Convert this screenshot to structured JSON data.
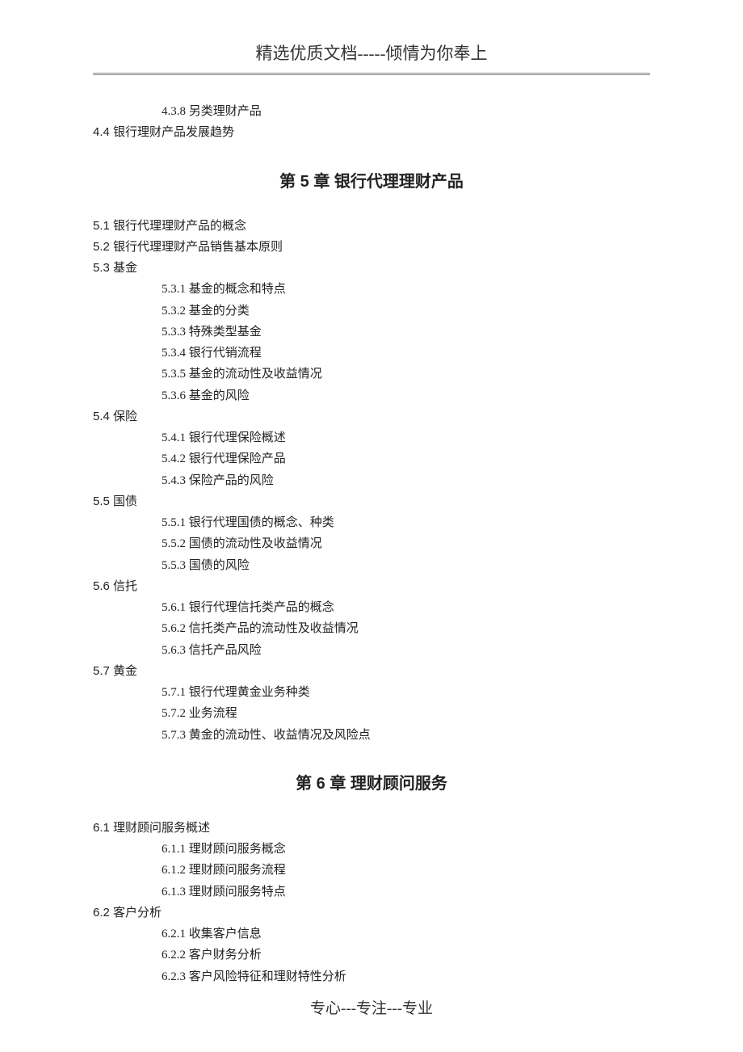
{
  "header": "精选优质文档-----倾情为你奉上",
  "footer": "专心---专注---专业",
  "preamble": {
    "item_4_3_8": "4.3.8 另类理财产品",
    "item_4_4": "4.4 银行理财产品发展趋势"
  },
  "chapter5": {
    "title": "第 5 章  银行代理理财产品",
    "s5_1": "5.1 银行代理理财产品的概念",
    "s5_2": "5.2 银行代理理财产品销售基本原则",
    "s5_3": "5.3 基金",
    "s5_3_1": "5.3.1 基金的概念和特点",
    "s5_3_2": "5.3.2 基金的分类",
    "s5_3_3": "5.3.3 特殊类型基金",
    "s5_3_4": "5.3.4 银行代销流程",
    "s5_3_5": "5.3.5 基金的流动性及收益情况",
    "s5_3_6": "5.3.6 基金的风险",
    "s5_4": "5.4 保险",
    "s5_4_1": "5.4.1 银行代理保险概述",
    "s5_4_2": "5.4.2 银行代理保险产品",
    "s5_4_3": "5.4.3 保险产品的风险",
    "s5_5": "5.5 国债",
    "s5_5_1": "5.5.1 银行代理国债的概念、种类",
    "s5_5_2": "5.5.2 国债的流动性及收益情况",
    "s5_5_3": "5.5.3 国债的风险",
    "s5_6": "5.6 信托",
    "s5_6_1": "5.6.1 银行代理信托类产品的概念",
    "s5_6_2": "5.6.2 信托类产品的流动性及收益情况",
    "s5_6_3": "5.6.3 信托产品风险",
    "s5_7": "5.7 黄金",
    "s5_7_1": "5.7.1 银行代理黄金业务种类",
    "s5_7_2": "5.7.2 业务流程",
    "s5_7_3": "5.7.3 黄金的流动性、收益情况及风险点"
  },
  "chapter6": {
    "title": "第 6 章  理财顾问服务",
    "s6_1": "6.1 理财顾问服务概述",
    "s6_1_1": "6.1.1 理财顾问服务概念",
    "s6_1_2": "6.1.2 理财顾问服务流程",
    "s6_1_3": "6.1.3 理财顾问服务特点",
    "s6_2": "6.2 客户分析",
    "s6_2_1": "6.2.1 收集客户信息",
    "s6_2_2": "6.2.2 客户财务分析",
    "s6_2_3": "6.2.3 客户风险特征和理财特性分析"
  }
}
